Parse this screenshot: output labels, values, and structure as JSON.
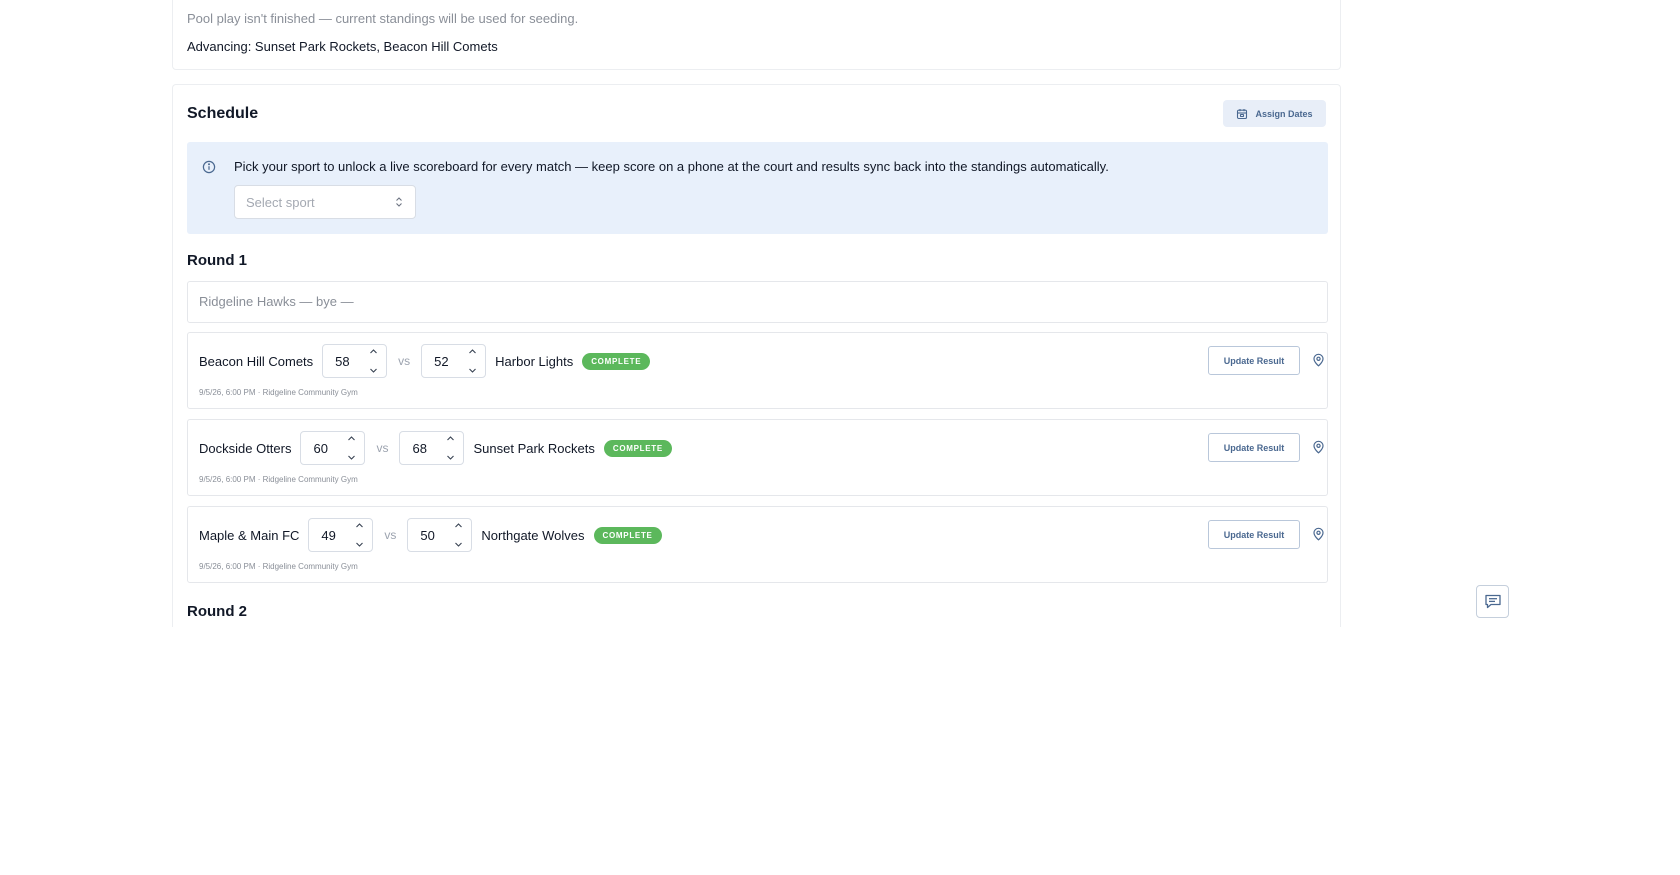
{
  "seeding": {
    "note": "Pool play isn't finished — current standings will be used for seeding.",
    "advancing": "Advancing: Sunset Park Rockets, Beacon Hill Comets"
  },
  "schedule": {
    "title": "Schedule",
    "assign_dates_label": "Assign Dates",
    "info_text": "Pick your sport to unlock a live scoreboard for every match — keep score on a phone at the court and results sync back into the standings automatically.",
    "sport_select_placeholder": "Select sport"
  },
  "rounds": [
    {
      "title": "Round 1",
      "bye": "Ridgeline Hawks — bye —",
      "matches": [
        {
          "home": "Beacon Hill Comets",
          "home_score": "58",
          "vs": "vs",
          "away_score": "52",
          "away": "Harbor Lights",
          "status": "COMPLETE",
          "meta": "9/5/26, 6:00 PM · Ridgeline Community Gym",
          "update_label": "Update Result"
        },
        {
          "home": "Dockside Otters",
          "home_score": "60",
          "vs": "vs",
          "away_score": "68",
          "away": "Sunset Park Rockets",
          "status": "COMPLETE",
          "meta": "9/5/26, 6:00 PM · Ridgeline Community Gym",
          "update_label": "Update Result"
        },
        {
          "home": "Maple & Main FC",
          "home_score": "49",
          "vs": "vs",
          "away_score": "50",
          "away": "Northgate Wolves",
          "status": "COMPLETE",
          "meta": "9/5/26, 6:00 PM · Ridgeline Community Gym",
          "update_label": "Update Result"
        }
      ]
    },
    {
      "title": "Round 2"
    }
  ],
  "icons": {
    "assign": "calendar-icon",
    "info": "info-icon",
    "select": "chevron-up-down-icon",
    "spin_up": "chevron-up-icon",
    "spin_down": "chevron-down-icon",
    "location": "location-pin-icon",
    "chat": "chat-bubble-icon"
  },
  "colors": {
    "accent": "#4a6890",
    "info_bg": "#e8f0fb",
    "complete_badge": "#5cb85c"
  }
}
